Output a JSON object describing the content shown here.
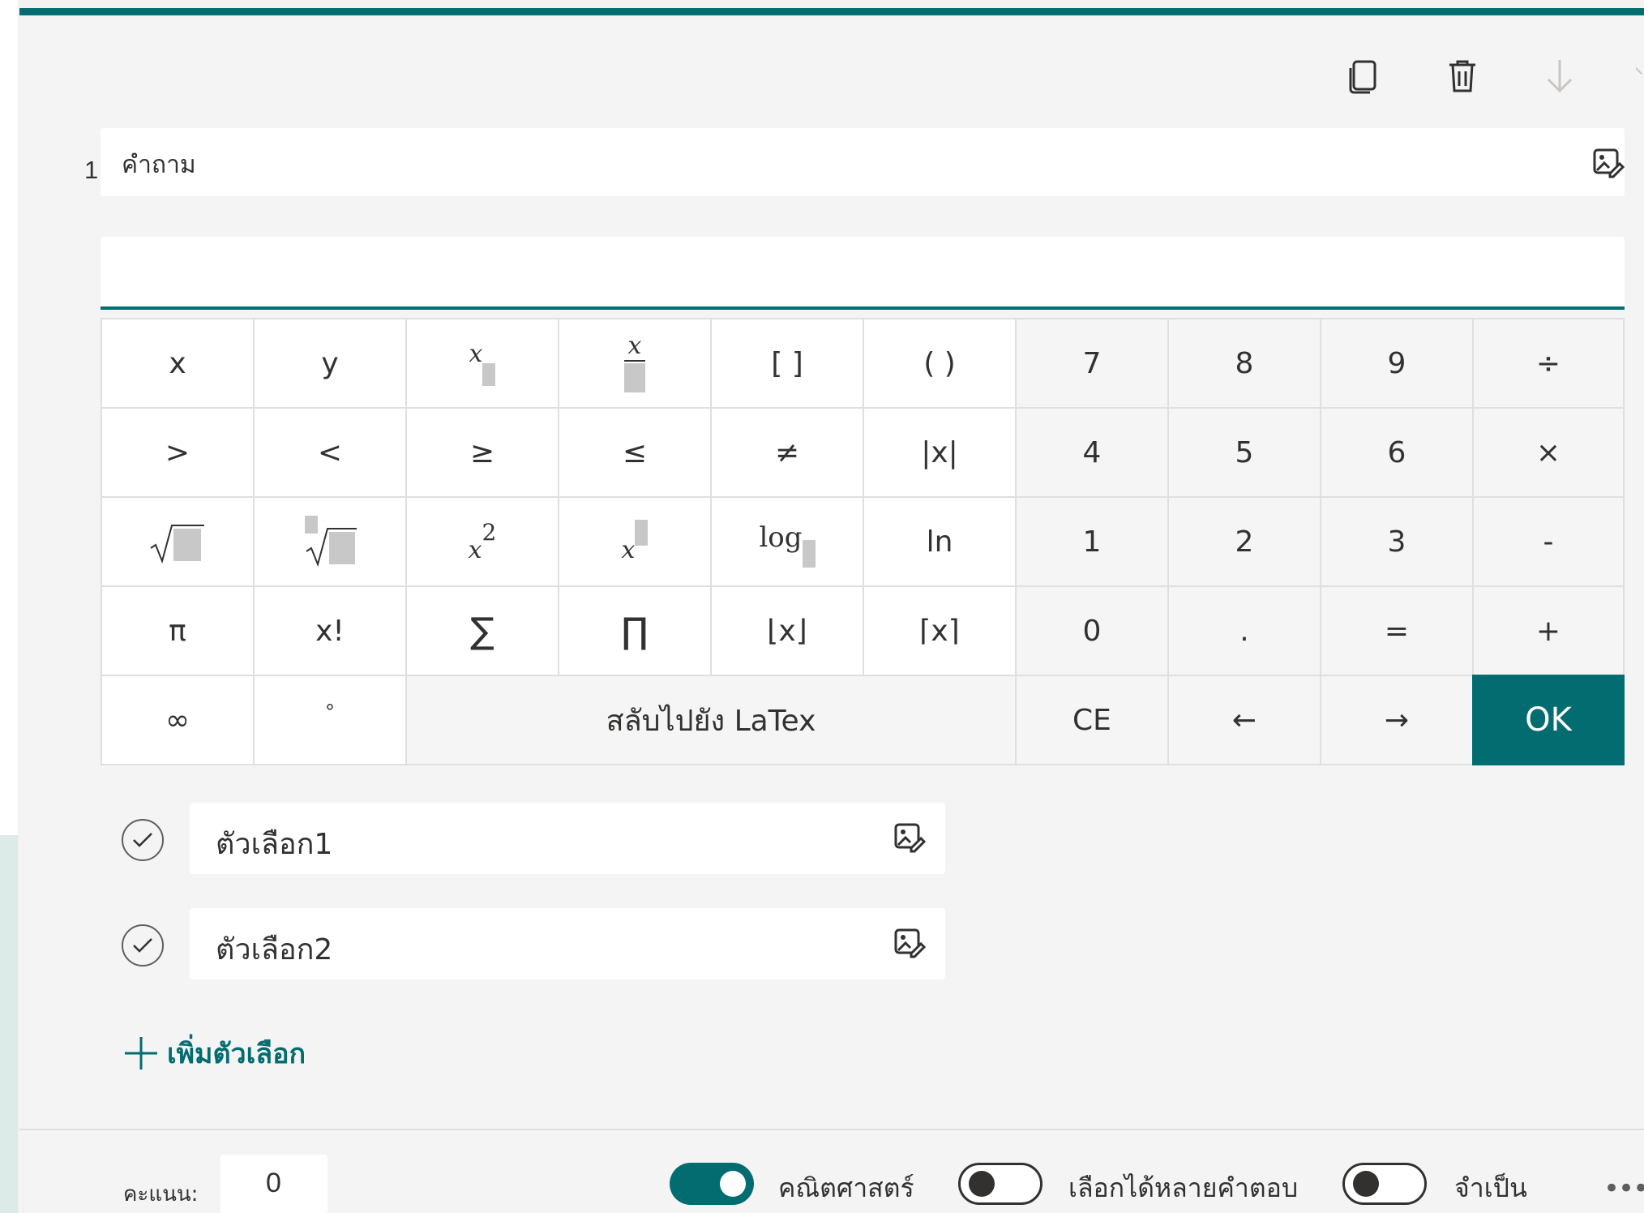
{
  "question": {
    "number": "1.",
    "placeholder": "คำถาม",
    "image_icon": "insert-image-icon"
  },
  "toolbar": {
    "icons": [
      "copy-icon",
      "delete-icon",
      "move-down-icon",
      "move-up-icon"
    ]
  },
  "math_input": {
    "value": ""
  },
  "keypad": {
    "row1": [
      "x",
      "y",
      "",
      "",
      "[ ]",
      "( )",
      "7",
      "8",
      "9",
      "÷"
    ],
    "row2": [
      ">",
      "<",
      "≥",
      "≤",
      "≠",
      "|x|",
      "4",
      "5",
      "6",
      "×"
    ],
    "row3": [
      "",
      "",
      "",
      "",
      "log",
      "ln",
      "1",
      "2",
      "3",
      "-"
    ],
    "row4": [
      "π",
      "x!",
      "∑",
      "∏",
      "⌊x⌋",
      "⌈x⌉",
      "0",
      ".",
      "=",
      "+"
    ],
    "row5": [
      "∞",
      "°",
      "สลับไปยัง LaTex",
      "CE",
      "←",
      "→",
      "OK"
    ],
    "sub_x": "x",
    "frac_x": "x",
    "sq_x": "x",
    "sq_2": "2",
    "pow_x": "x"
  },
  "options": [
    {
      "label": "ตัวเลือก1"
    },
    {
      "label": "ตัวเลือก2"
    }
  ],
  "add_option": "เพิ่มตัวเลือก",
  "footer": {
    "points_label": "คะแนน:",
    "points_value": "0",
    "toggles": [
      {
        "label": "คณิตศาสตร์",
        "on": true
      },
      {
        "label": "เลือกได้หลายคำตอบ",
        "on": false
      },
      {
        "label": "จำเป็น",
        "on": false
      }
    ],
    "more": "•••"
  },
  "colors": {
    "accent": "#036c70",
    "background": "#f4f4f4",
    "key_border": "#e1dfdd"
  }
}
